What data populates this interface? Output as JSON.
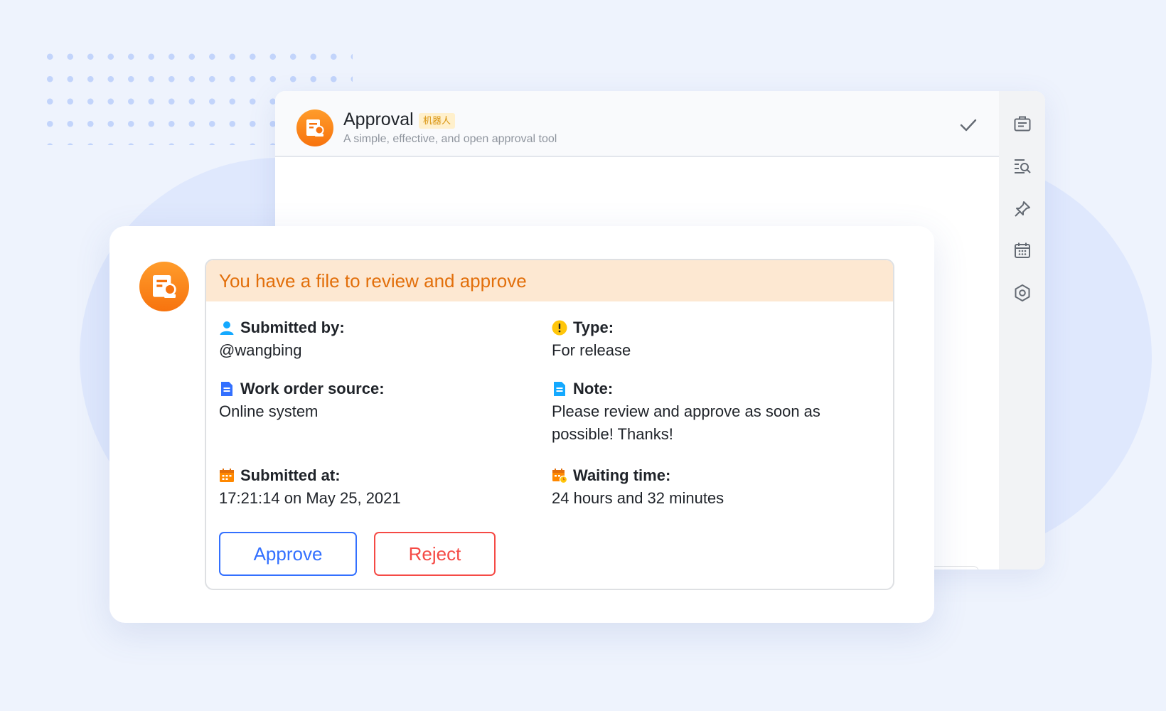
{
  "back_window": {
    "app_name": "Approval",
    "robot_tag": "机器人",
    "description": "A simple, effective, and open approval tool",
    "sidebar_icons": [
      "briefcase-icon",
      "search-list-icon",
      "pin-icon",
      "calendar-icon",
      "settings-icon"
    ]
  },
  "card": {
    "header": "You have a file to review and approve",
    "fields": {
      "submitted_by": {
        "label": "Submitted by:",
        "value": "@wangbing"
      },
      "type": {
        "label": "Type:",
        "value": "For release"
      },
      "work_order_source": {
        "label": "Work order source:",
        "value": "Online system"
      },
      "note": {
        "label": "Note:",
        "value": "Please review and approve as soon as possible! Thanks!"
      },
      "submitted_at": {
        "label": "Submitted at:",
        "value": "17:21:14 on May 25, 2021"
      },
      "waiting_time": {
        "label": "Waiting time:",
        "value": "24 hours and 32 minutes"
      }
    },
    "buttons": {
      "approve": "Approve",
      "reject": "Reject"
    }
  },
  "colors": {
    "accent": "#3370ff",
    "danger": "#f54a45",
    "brand_orange": "#f7730e",
    "header_bg": "#fde8d2",
    "header_text": "#e26f0b"
  }
}
